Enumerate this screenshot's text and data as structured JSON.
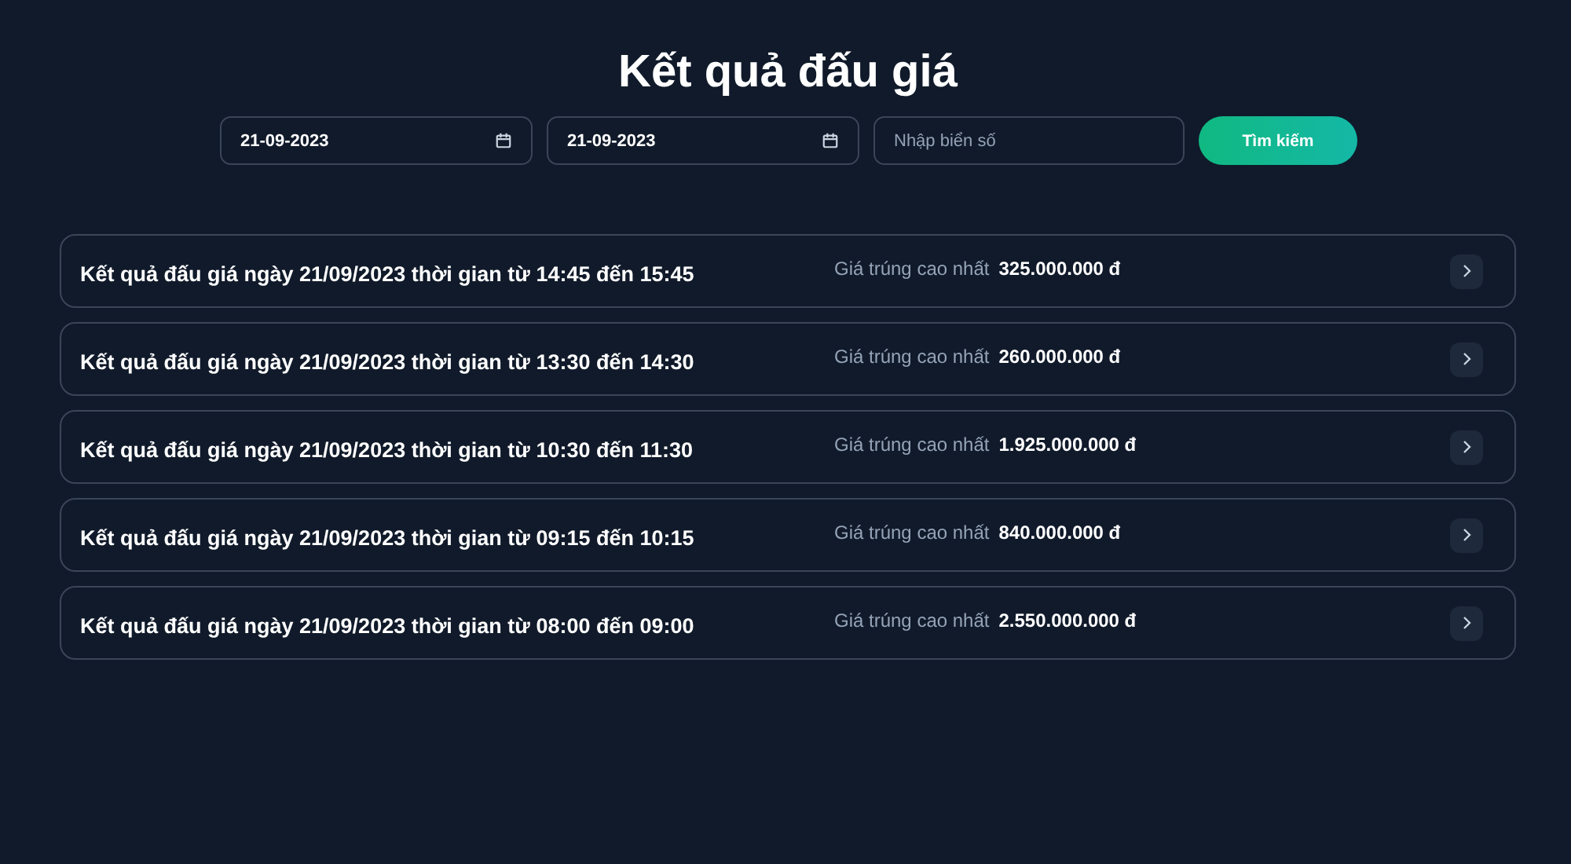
{
  "title": "Kết quả đấu giá",
  "filters": {
    "date_from": "21-09-2023",
    "date_to": "21-09-2023",
    "plate_placeholder": "Nhập biển số",
    "search_button": "Tìm kiếm"
  },
  "results": [
    {
      "title": "Kết quả đấu giá ngày 21/09/2023 thời gian từ 14:45 đến 15:45",
      "price_label": "Giá trúng cao nhất",
      "price": "325.000.000 đ"
    },
    {
      "title": "Kết quả đấu giá ngày 21/09/2023 thời gian từ 13:30 đến 14:30",
      "price_label": "Giá trúng cao nhất",
      "price": "260.000.000 đ"
    },
    {
      "title": "Kết quả đấu giá ngày 21/09/2023 thời gian từ 10:30 đến 11:30",
      "price_label": "Giá trúng cao nhất",
      "price": "1.925.000.000 đ"
    },
    {
      "title": "Kết quả đấu giá ngày 21/09/2023 thời gian từ 09:15 đến 10:15",
      "price_label": "Giá trúng cao nhất",
      "price": "840.000.000 đ"
    },
    {
      "title": "Kết quả đấu giá ngày 21/09/2023 thời gian từ 08:00 đến 09:00",
      "price_label": "Giá trúng cao nhất",
      "price": "2.550.000.000 đ"
    }
  ]
}
